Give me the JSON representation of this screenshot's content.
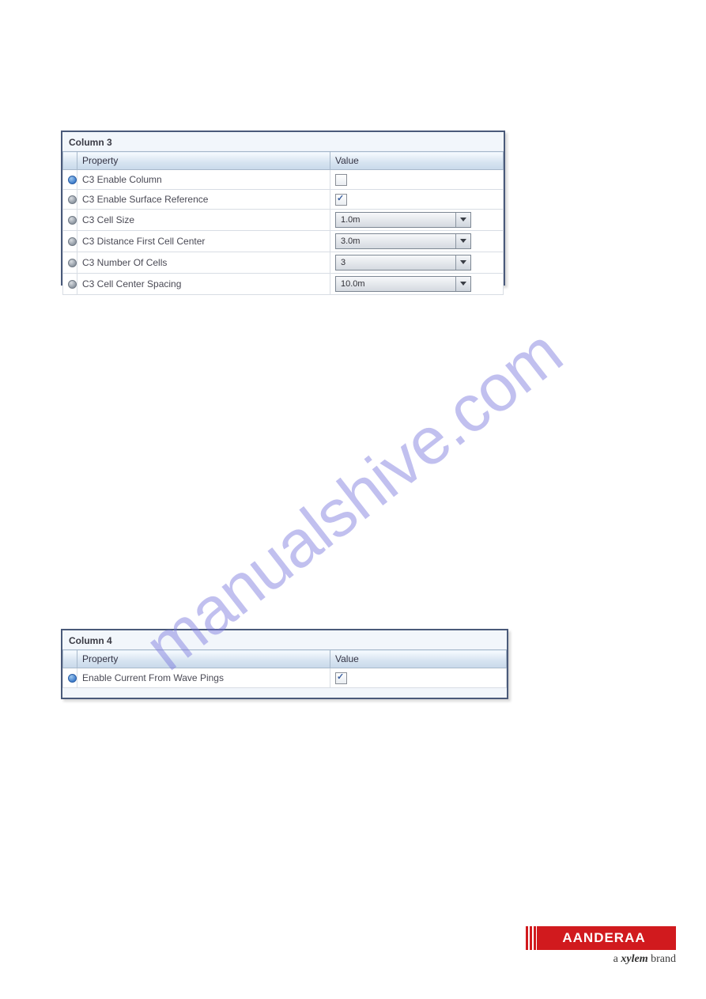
{
  "watermark": "manualshive.com",
  "panels": [
    {
      "title": "Column 3",
      "headers": {
        "property": "Property",
        "value": "Value"
      },
      "rows": [
        {
          "bullet": "blue",
          "label": "C3 Enable Column",
          "type": "checkbox",
          "checked": false
        },
        {
          "bullet": "gray",
          "label": "C3 Enable Surface Reference",
          "type": "checkbox",
          "checked": true
        },
        {
          "bullet": "gray",
          "label": "C3 Cell Size",
          "type": "combo",
          "value": "1.0m"
        },
        {
          "bullet": "gray",
          "label": "C3 Distance First Cell Center",
          "type": "combo",
          "value": "3.0m"
        },
        {
          "bullet": "gray",
          "label": "C3 Number Of Cells",
          "type": "combo",
          "value": "3"
        },
        {
          "bullet": "gray",
          "label": "C3 Cell Center Spacing",
          "type": "combo",
          "value": "10.0m"
        }
      ]
    },
    {
      "title": "Column 4",
      "headers": {
        "property": "Property",
        "value": "Value"
      },
      "rows": [
        {
          "bullet": "blue",
          "label": "Enable Current From Wave Pings",
          "type": "checkbox",
          "checked": true
        }
      ]
    }
  ],
  "logo": {
    "brand": "AANDERAA",
    "tagline_prefix": "a ",
    "tagline_brand": "xylem",
    "tagline_suffix": " brand"
  }
}
